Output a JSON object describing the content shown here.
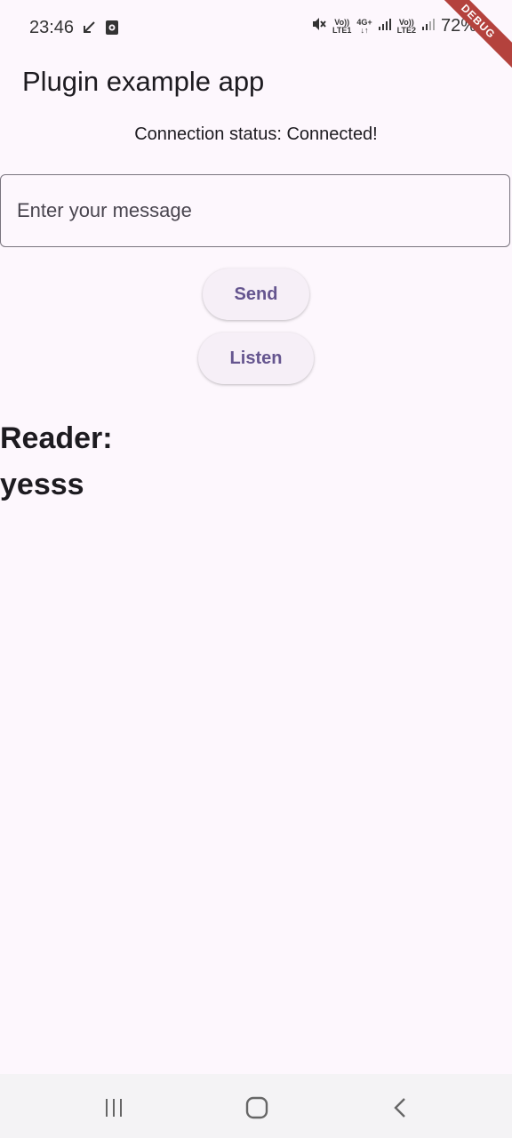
{
  "status_bar": {
    "time": "23:46",
    "sim1_label_top": "Vo))",
    "sim1_label_bottom": "LTE1",
    "net_type": "4G+",
    "sim2_label_top": "Vo))",
    "sim2_label_bottom": "LTE2",
    "battery": "72%",
    "debug_banner": "DEBUG"
  },
  "app_bar": {
    "title": "Plugin example app"
  },
  "main": {
    "connection_status": "Connection status: Connected!",
    "message_placeholder": "Enter your message",
    "send_label": "Send",
    "listen_label": "Listen",
    "reader_label": "Reader:",
    "reader_value": "yesss"
  },
  "nav_bar": {
    "icons": [
      "recent-apps-icon",
      "home-icon",
      "back-icon"
    ]
  },
  "colors": {
    "background": "#fdf7fd",
    "button_text": "#65558f",
    "button_bg": "#f6eff7",
    "debug_ribbon": "#b4423d"
  }
}
